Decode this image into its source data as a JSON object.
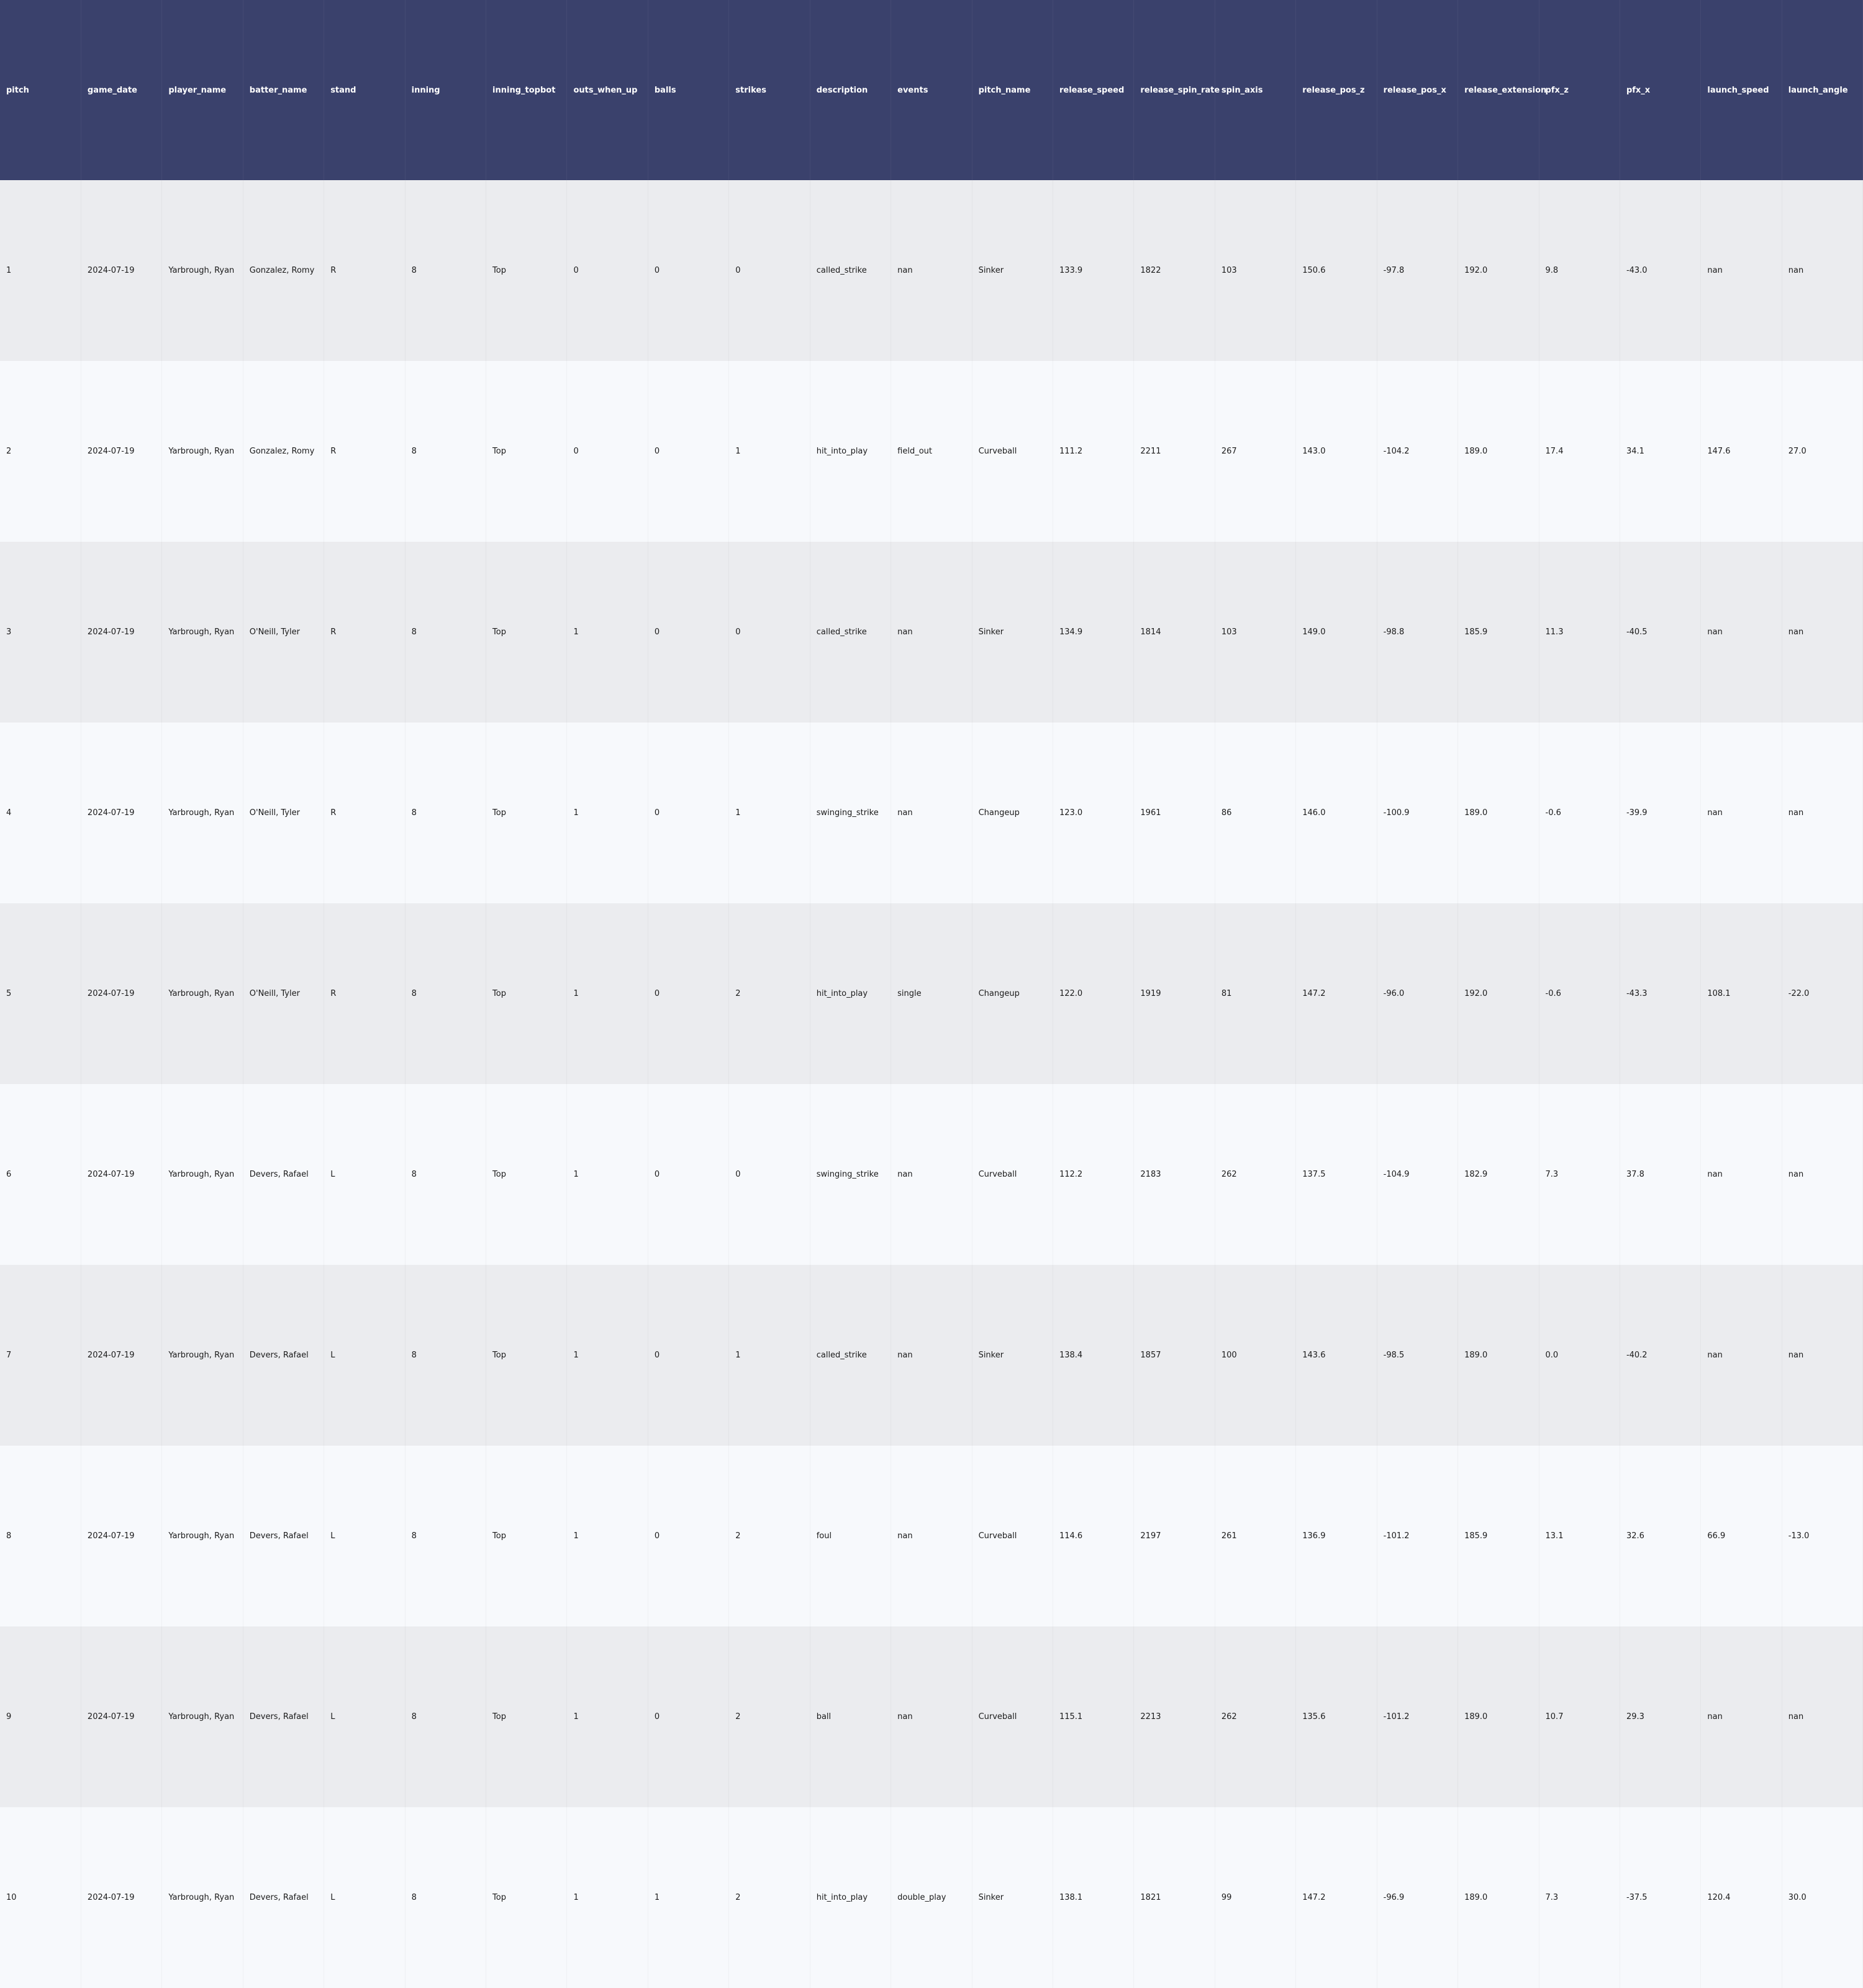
{
  "chart_data": {
    "type": "table",
    "columns": [
      "pitch",
      "game_date",
      "player_name",
      "batter_name",
      "stand",
      "inning",
      "inning_topbot",
      "outs_when_up",
      "balls",
      "strikes",
      "description",
      "events",
      "pitch_name",
      "release_speed",
      "release_spin_rate",
      "spin_axis",
      "release_pos_z",
      "release_pos_x",
      "release_extension",
      "pfx_z",
      "pfx_x",
      "launch_speed",
      "launch_angle"
    ],
    "rows": [
      [
        "1",
        "2024-07-19",
        "Yarbrough, Ryan",
        "Gonzalez, Romy",
        "R",
        "8",
        "Top",
        "0",
        "0",
        "0",
        "called_strike",
        "nan",
        "Sinker",
        "133.9",
        "1822",
        "103",
        "150.6",
        "-97.8",
        "192.0",
        "9.8",
        "-43.0",
        "nan",
        "nan"
      ],
      [
        "2",
        "2024-07-19",
        "Yarbrough, Ryan",
        "Gonzalez, Romy",
        "R",
        "8",
        "Top",
        "0",
        "0",
        "1",
        "hit_into_play",
        "field_out",
        "Curveball",
        "111.2",
        "2211",
        "267",
        "143.0",
        "-104.2",
        "189.0",
        "17.4",
        "34.1",
        "147.6",
        "27.0"
      ],
      [
        "3",
        "2024-07-19",
        "Yarbrough, Ryan",
        "O'Neill, Tyler",
        "R",
        "8",
        "Top",
        "1",
        "0",
        "0",
        "called_strike",
        "nan",
        "Sinker",
        "134.9",
        "1814",
        "103",
        "149.0",
        "-98.8",
        "185.9",
        "11.3",
        "-40.5",
        "nan",
        "nan"
      ],
      [
        "4",
        "2024-07-19",
        "Yarbrough, Ryan",
        "O'Neill, Tyler",
        "R",
        "8",
        "Top",
        "1",
        "0",
        "1",
        "swinging_strike",
        "nan",
        "Changeup",
        "123.0",
        "1961",
        "86",
        "146.0",
        "-100.9",
        "189.0",
        "-0.6",
        "-39.9",
        "nan",
        "nan"
      ],
      [
        "5",
        "2024-07-19",
        "Yarbrough, Ryan",
        "O'Neill, Tyler",
        "R",
        "8",
        "Top",
        "1",
        "0",
        "2",
        "hit_into_play",
        "single",
        "Changeup",
        "122.0",
        "1919",
        "81",
        "147.2",
        "-96.0",
        "192.0",
        "-0.6",
        "-43.3",
        "108.1",
        "-22.0"
      ],
      [
        "6",
        "2024-07-19",
        "Yarbrough, Ryan",
        "Devers, Rafael",
        "L",
        "8",
        "Top",
        "1",
        "0",
        "0",
        "swinging_strike",
        "nan",
        "Curveball",
        "112.2",
        "2183",
        "262",
        "137.5",
        "-104.9",
        "182.9",
        "7.3",
        "37.8",
        "nan",
        "nan"
      ],
      [
        "7",
        "2024-07-19",
        "Yarbrough, Ryan",
        "Devers, Rafael",
        "L",
        "8",
        "Top",
        "1",
        "0",
        "1",
        "called_strike",
        "nan",
        "Sinker",
        "138.4",
        "1857",
        "100",
        "143.6",
        "-98.5",
        "189.0",
        "0.0",
        "-40.2",
        "nan",
        "nan"
      ],
      [
        "8",
        "2024-07-19",
        "Yarbrough, Ryan",
        "Devers, Rafael",
        "L",
        "8",
        "Top",
        "1",
        "0",
        "2",
        "foul",
        "nan",
        "Curveball",
        "114.6",
        "2197",
        "261",
        "136.9",
        "-101.2",
        "185.9",
        "13.1",
        "32.6",
        "66.9",
        "-13.0"
      ],
      [
        "9",
        "2024-07-19",
        "Yarbrough, Ryan",
        "Devers, Rafael",
        "L",
        "8",
        "Top",
        "1",
        "0",
        "2",
        "ball",
        "nan",
        "Curveball",
        "115.1",
        "2213",
        "262",
        "135.6",
        "-101.2",
        "189.0",
        "10.7",
        "29.3",
        "nan",
        "nan"
      ],
      [
        "10",
        "2024-07-19",
        "Yarbrough, Ryan",
        "Devers, Rafael",
        "L",
        "8",
        "Top",
        "1",
        "1",
        "2",
        "hit_into_play",
        "double_play",
        "Sinker",
        "138.1",
        "1821",
        "99",
        "147.2",
        "-96.9",
        "189.0",
        "7.3",
        "-37.5",
        "120.4",
        "30.0"
      ]
    ],
    "header_color": "#3a416c",
    "header_text_color": "#ffffff",
    "row_colors": [
      "#ebecef",
      "#f7f9fc"
    ]
  }
}
